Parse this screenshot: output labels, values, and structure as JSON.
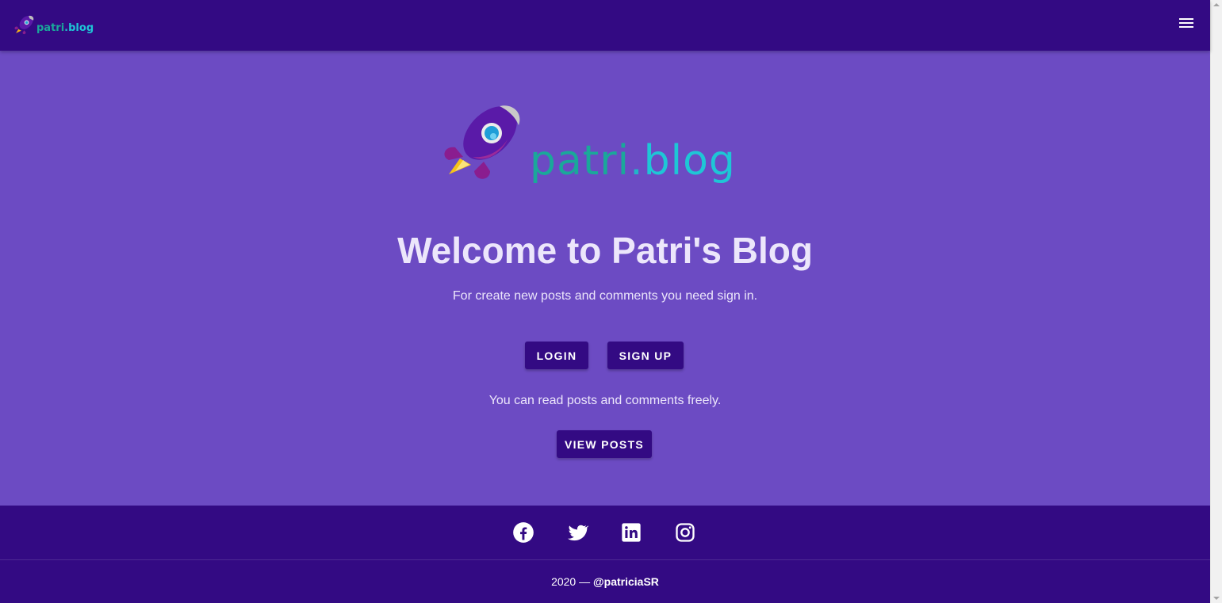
{
  "header": {
    "logo": {
      "brand_name": "patri",
      "brand_dot": ".",
      "brand_suffix": "blog"
    },
    "menu_icon": "hamburger-menu-icon"
  },
  "hero": {
    "logo": {
      "brand_name": "patri",
      "brand_dot": ".",
      "brand_suffix": "blog",
      "icon": "rocket-icon"
    },
    "title": "Welcome to Patri's Blog",
    "subtitle": "For create new posts and comments you need sign in.",
    "login_label": "LOGIN",
    "signup_label": "SIGN UP",
    "free_text": "You can read posts and comments freely.",
    "view_posts_label": "VIEW POSTS"
  },
  "footer": {
    "social": [
      "facebook-icon",
      "twitter-icon",
      "linkedin-icon",
      "instagram-icon"
    ],
    "year": "2020",
    "separator": " — ",
    "handle": "@patriciaSR"
  },
  "colors": {
    "appbar": "#330a83",
    "background": "#6c4bc3",
    "button": "#330a83",
    "text_light": "#ece6fb",
    "brand_teal": "#1aa89a"
  }
}
